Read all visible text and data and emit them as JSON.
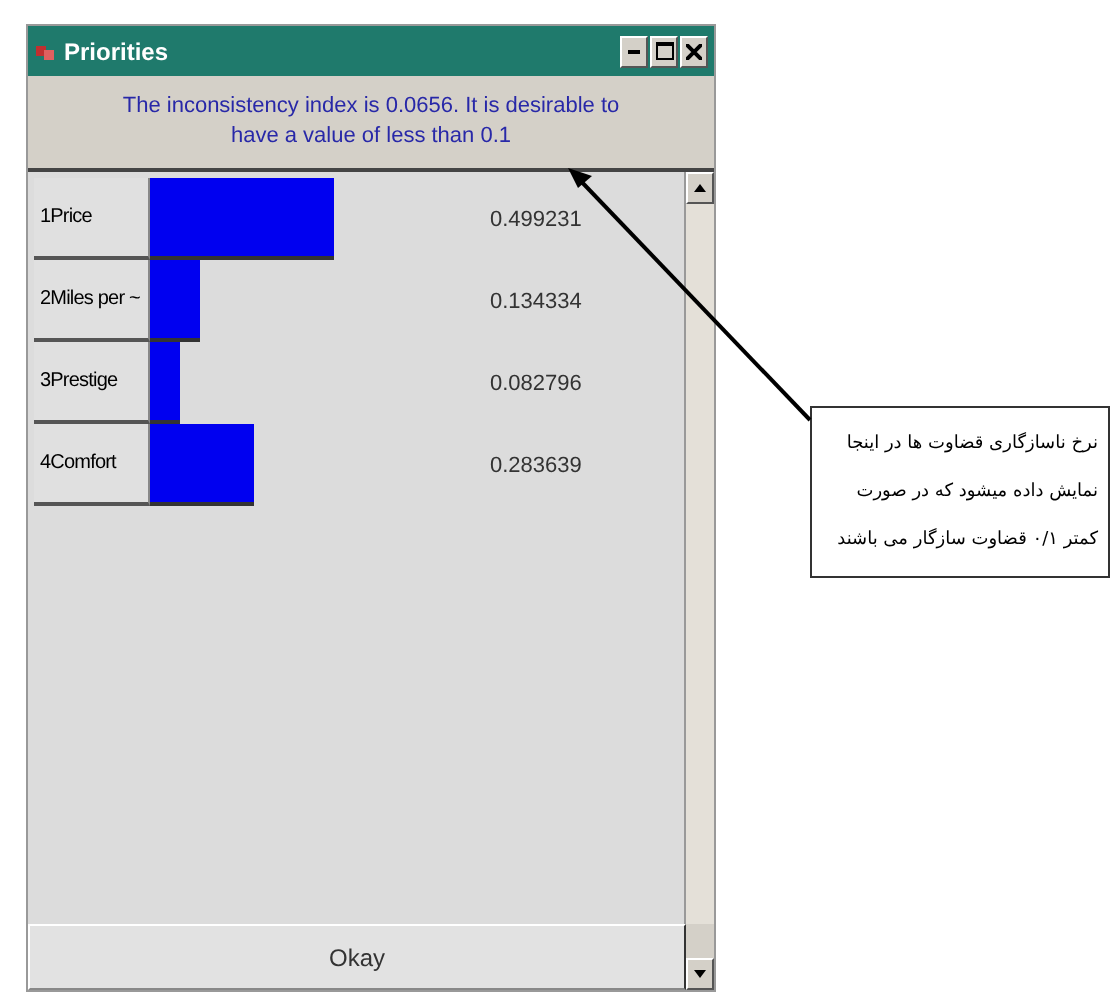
{
  "window": {
    "title": "Priorities"
  },
  "message": "The inconsistency index is 0.0656.  It is desirable to have a value of less than 0.1",
  "rows": [
    {
      "label": "1Price",
      "value": "0.499231"
    },
    {
      "label": "2Miles per ~",
      "value": "0.134334"
    },
    {
      "label": "3Prestige",
      "value": "0.082796"
    },
    {
      "label": "4Comfort",
      "value": "0.283639"
    }
  ],
  "buttons": [
    "Okay"
  ],
  "callout": {
    "lines": [
      "نرخ ناسازگاری قضاوت ها در اینجا",
      "نمایش داده میشود که در صورت",
      "کمتر ۰/۱ قضاوت سازگار می باشند"
    ]
  }
}
